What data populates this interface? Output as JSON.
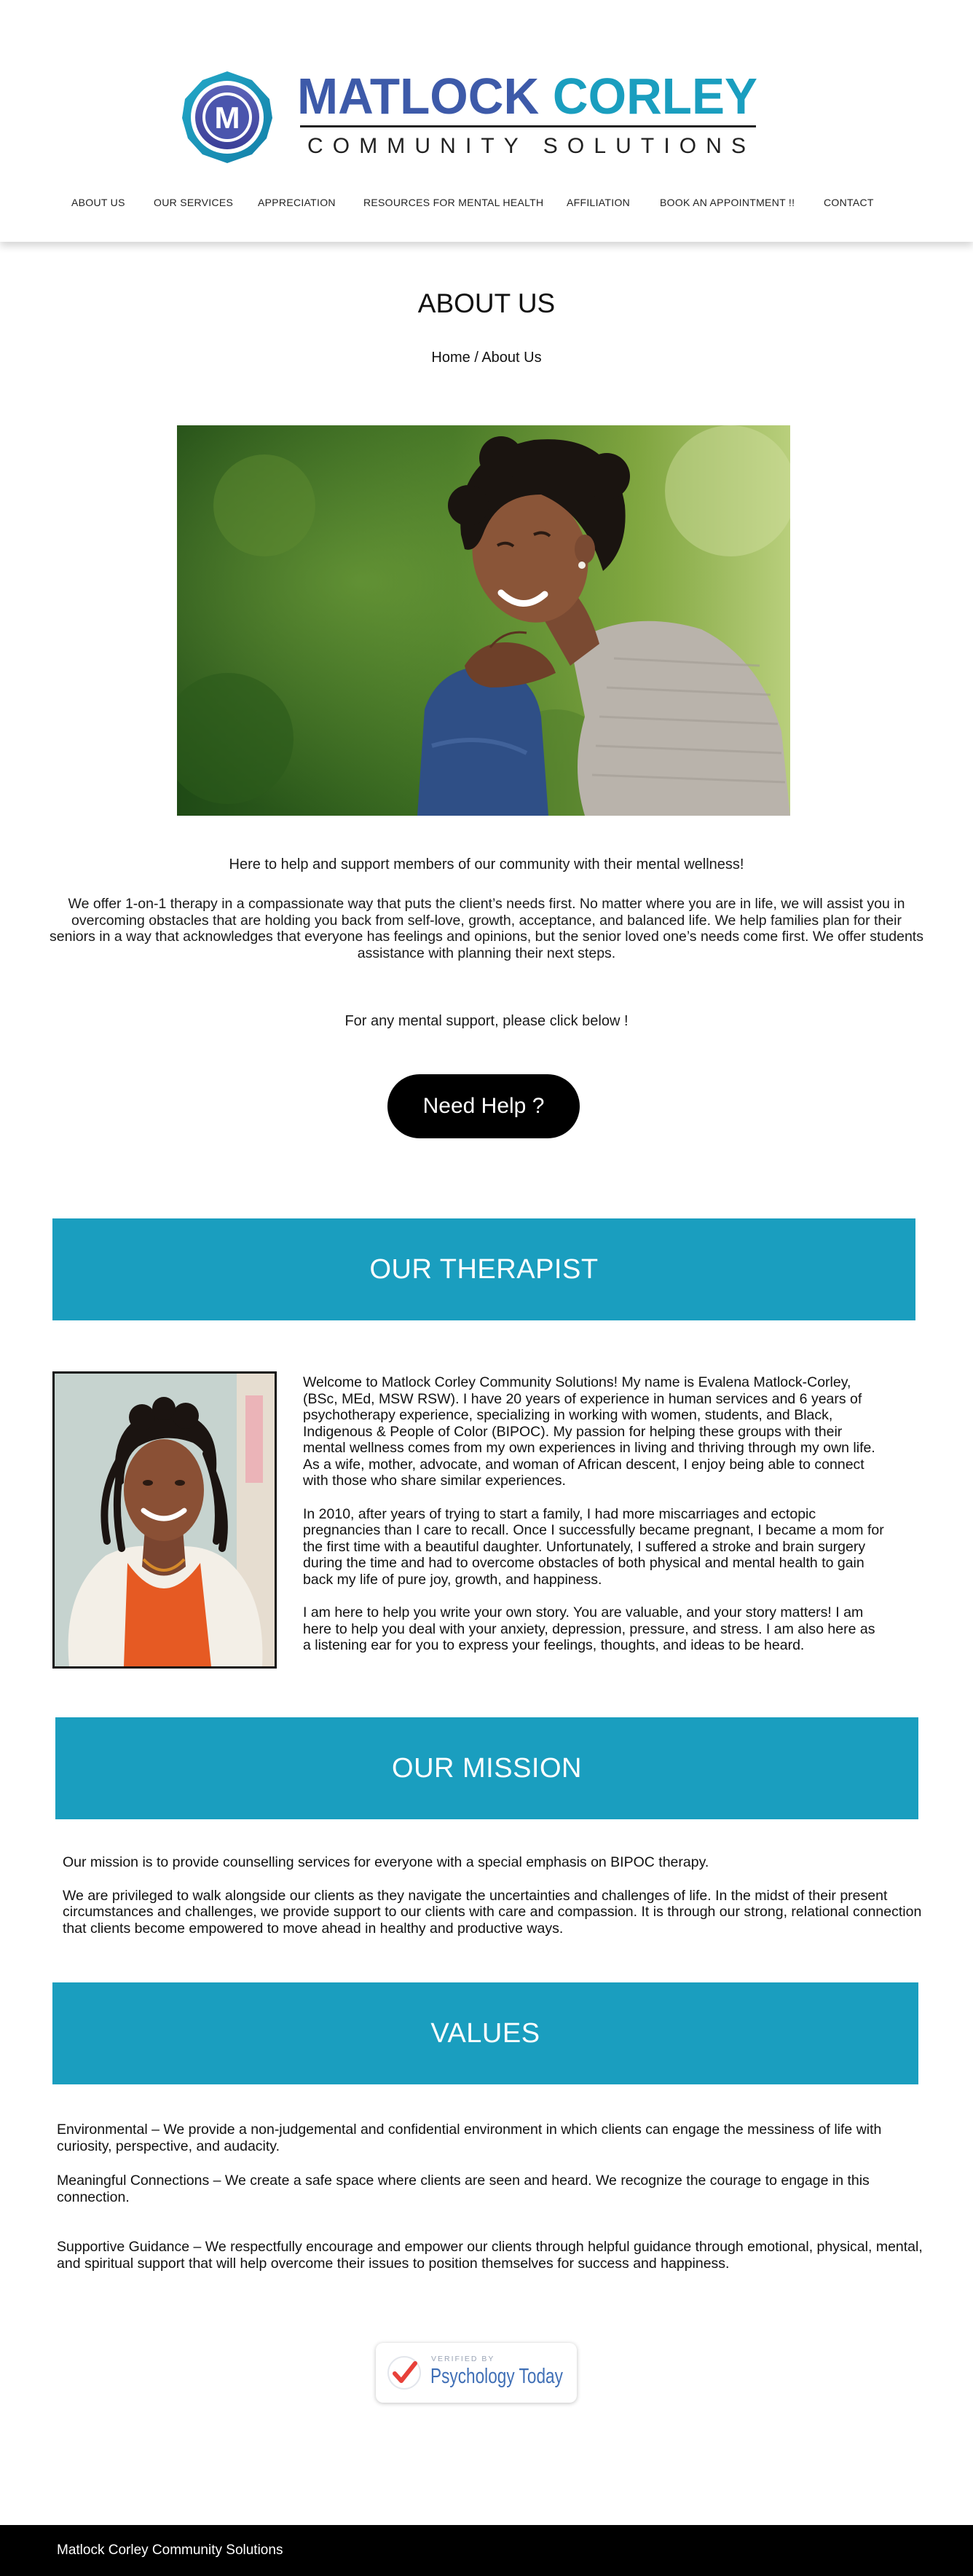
{
  "brand": {
    "name": "MATLOCK CORLEY",
    "name_part1": "MATLOCK",
    "name_part2": "CORLEY",
    "subtitle": "COMMUNITY SOLUTIONS",
    "monogram": "M",
    "colors": {
      "dark_blue": "#3d5aa9",
      "teal": "#1a9ebf"
    }
  },
  "nav": {
    "items": [
      {
        "label": "ABOUT US"
      },
      {
        "label": "OUR SERVICES"
      },
      {
        "label": "APPRECIATION"
      },
      {
        "label": "RESOURCES FOR MENTAL HEALTH"
      },
      {
        "label": "AFFILIATION"
      },
      {
        "label": "BOOK AN APPOINTMENT !!"
      },
      {
        "label": "CONTACT"
      }
    ]
  },
  "about": {
    "title": "ABOUT US",
    "breadcrumb": "Home / About  Us",
    "tagline": "Here to help and support members of our community with their mental wellness!",
    "body": "We offer 1-on-1 therapy in a compassionate way that puts the client’s needs first. No matter where you are in life, we will assist you in overcoming obstacles that are holding you back from self-love, growth, acceptance, and balanced life. We help families plan for their seniors in a way that acknowledges that everyone has feelings and opinions, but the senior loved one’s needs come first. We offer students assistance with planning their next steps.",
    "support_prompt": "For any mental support, please click below !",
    "help_button": "Need Help ?"
  },
  "therapist": {
    "heading": "OUR THERAPIST",
    "paragraphs": [
      "Welcome to Matlock Corley Community Solutions! My name is Evalena Matlock-Corley, (BSc, MEd, MSW RSW). I have 20 years of experience in human services and 6 years of psychotherapy experience, specializing in working with women, students, and Black, Indigenous & People of Color (BIPOC). My passion for helping these groups with their mental wellness comes from my own experiences in living and thriving through my own life. As a wife, mother, advocate, and woman of African descent, I enjoy being able to connect with those who share similar experiences.",
      "In 2010, after years of trying to start a family, I had more miscarriages and ectopic pregnancies than I care to recall. Once I successfully became pregnant, I became a mom for the first time with a beautiful daughter. Unfortunately, I suffered a stroke and brain surgery during the time and had to overcome obstacles of both physical and mental health to gain back my life of pure joy, growth, and happiness.",
      "I am here to help you write your own story. You are valuable, and your story matters! I am here to help you deal with your anxiety, depression, pressure, and stress. I am also here as a listening ear for you to express your feelings, thoughts, and ideas to be heard."
    ]
  },
  "mission": {
    "heading": "OUR MISSION",
    "paragraphs": [
      "Our mission is to provide counselling services for everyone with a special emphasis on BIPOC therapy.",
      "We are privileged to walk alongside our clients as they navigate the uncertainties and challenges of life. In the midst of their present circumstances and challenges, we provide support to our clients with care and compassion. It is through our strong, relational connection that clients become empowered to move ahead in healthy and productive ways."
    ]
  },
  "values": {
    "heading": "VALUES",
    "items": [
      "Environmental – We provide a non-judgemental and confidential environment in which clients can engage the messiness of life with curiosity, perspective, and audacity.",
      "Meaningful Connections – We create a safe space where clients are seen and heard. We recognize the courage to engage in this connection.",
      "Supportive Guidance – We respectfully encourage and empower our clients through helpful guidance through emotional, physical, mental, and spiritual support that will help overcome their issues to position themselves for success and happiness."
    ]
  },
  "badge": {
    "verified": "VERIFIED BY",
    "brand": "Psychology Today",
    "icon": "checkmark-icon"
  },
  "footer": {
    "text": "Matlock Corley Community Solutions"
  }
}
